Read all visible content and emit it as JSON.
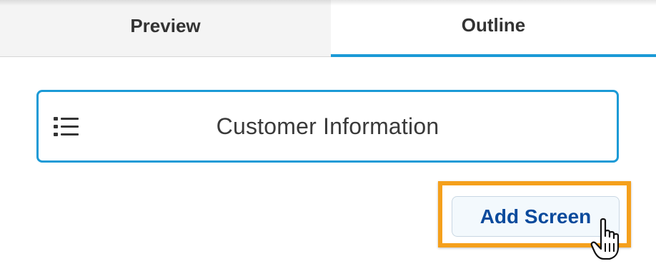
{
  "tabs": [
    {
      "label": "Preview",
      "active": false
    },
    {
      "label": "Outline",
      "active": true
    }
  ],
  "outline": {
    "screens": [
      {
        "title": "Customer Information",
        "icon": "list-icon"
      }
    ]
  },
  "add_screen_button": {
    "label": "Add Screen",
    "highlighted": true,
    "cursor": "hand-pointer-icon"
  },
  "colors": {
    "accent": "#1b9ad6",
    "highlight": "#f5a01c",
    "button_text": "#0a4a9c"
  }
}
